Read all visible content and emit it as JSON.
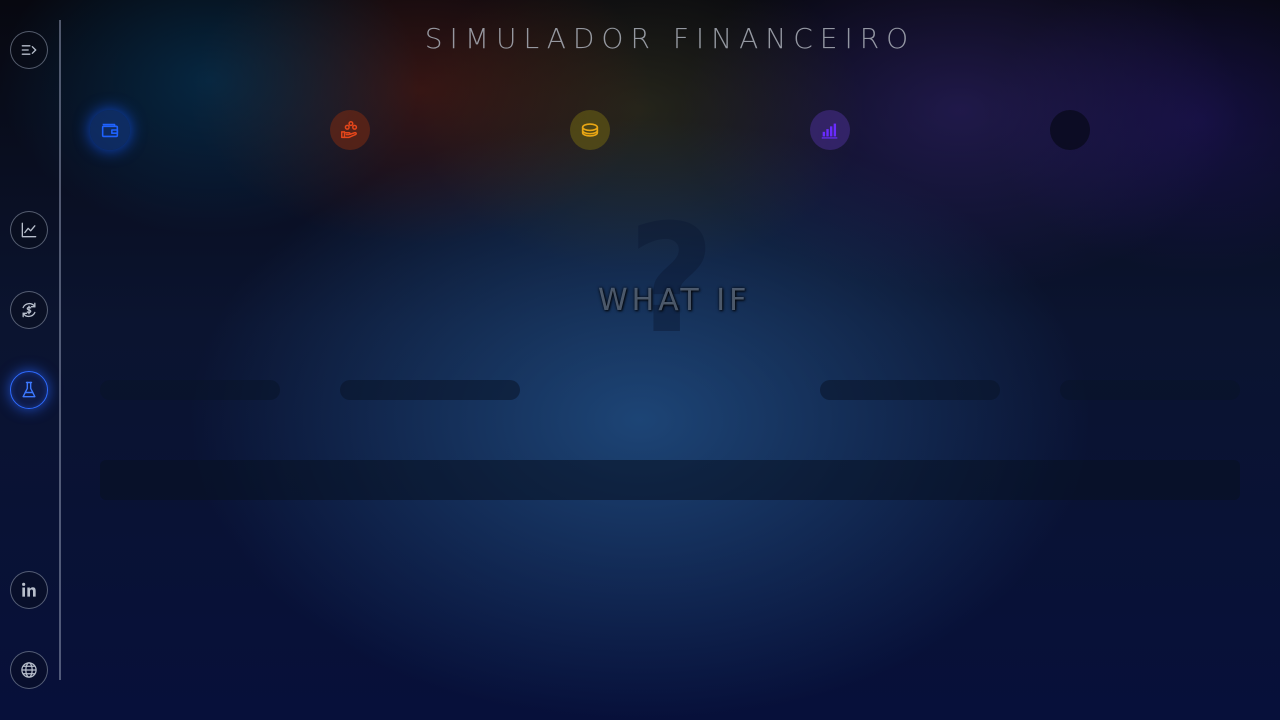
{
  "app": {
    "title": "SIMULADOR FINANCEIRO"
  },
  "sidebar": {
    "items": [
      {
        "name": "toggle-menu",
        "icon": "menu-collapse-icon"
      },
      {
        "name": "chart",
        "icon": "line-chart-icon"
      },
      {
        "name": "exchange",
        "icon": "currency-exchange-icon"
      },
      {
        "name": "lab",
        "icon": "flask-icon",
        "active": true
      },
      {
        "name": "linkedin",
        "icon": "linkedin-icon"
      },
      {
        "name": "website",
        "icon": "globe-icon"
      }
    ]
  },
  "categories": [
    {
      "icon": "wallet-icon",
      "color": "#1a5cff",
      "active": true
    },
    {
      "icon": "hand-coins-icon",
      "color": "#e0451c"
    },
    {
      "icon": "coin-stack-icon",
      "color": "#e6a815"
    },
    {
      "icon": "bar-chart-icon",
      "color": "#6a2cff"
    },
    {
      "icon": "empty-icon",
      "color": "#14142a"
    }
  ],
  "main": {
    "question_mark": "?",
    "what_if_label": "WHAT IF"
  },
  "colors": {
    "accent": "#2f6bff",
    "sidebar_border": "#8c96af",
    "title_text": "#aaafb9"
  }
}
